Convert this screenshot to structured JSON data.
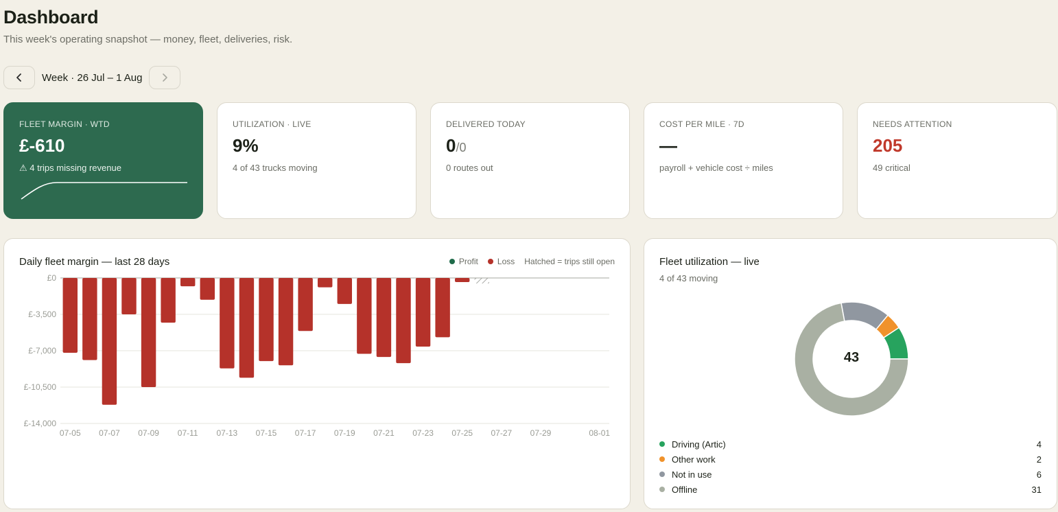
{
  "header": {
    "title": "Dashboard",
    "subtitle": "This week's operating snapshot — money, fleet, deliveries, risk."
  },
  "week_nav": {
    "prev_icon": "chevron-left-icon",
    "next_icon": "chevron-right-icon",
    "label": "Week · 26 Jul – 1 Aug"
  },
  "kpis": [
    {
      "label": "FLEET MARGIN · WTD",
      "value": "£-610",
      "sub": "⚠ 4 trips missing revenue",
      "accent": "#2d6a4f"
    },
    {
      "label": "UTILIZATION · LIVE",
      "value": "9%",
      "sub": "4 of 43 trucks moving"
    },
    {
      "label": "DELIVERED TODAY",
      "value": "0",
      "value_suffix": "/0",
      "sub": "0 routes out"
    },
    {
      "label": "COST PER MILE · 7D",
      "value": "—",
      "sub": "payroll + vehicle cost ÷ miles"
    },
    {
      "label": "NEEDS ATTENTION",
      "value": "205",
      "sub": "49 critical",
      "accent": "#c0392b"
    }
  ],
  "margin_chart": {
    "title": "Daily fleet margin — last 28 days",
    "legend": {
      "profit": "Profit",
      "loss": "Loss",
      "note": "Hatched = trips still open"
    },
    "colors": {
      "profit": "#1f6b4a",
      "loss": "#b5322a",
      "grid": "#e6e4dc",
      "axis": "#9a9c95"
    }
  },
  "chart_data": {
    "type": "bar",
    "title": "Daily fleet margin — last 28 days",
    "x": [
      "07-05",
      "07-06",
      "07-07",
      "07-08",
      "07-09",
      "07-10",
      "07-11",
      "07-12",
      "07-13",
      "07-14",
      "07-15",
      "07-16",
      "07-17",
      "07-18",
      "07-19",
      "07-20",
      "07-21",
      "07-22",
      "07-23",
      "07-24",
      "07-25",
      "07-26",
      "07-27",
      "07-28",
      "07-29",
      "07-30",
      "07-31",
      "08-01"
    ],
    "values": [
      -7200,
      -7900,
      -12200,
      -3500,
      -10500,
      -4300,
      -800,
      -2100,
      -8700,
      -9600,
      -8000,
      -8400,
      -5100,
      -900,
      -2500,
      -7300,
      -7600,
      -8200,
      -6600,
      -5700,
      -400,
      null,
      null,
      null,
      null,
      null,
      null,
      null
    ],
    "open_days": [
      "07-26"
    ],
    "tick_labels_x": [
      "07-05",
      "07-07",
      "07-09",
      "07-11",
      "07-13",
      "07-15",
      "07-17",
      "07-19",
      "07-21",
      "07-23",
      "07-25",
      "07-27",
      "07-29",
      "08-01"
    ],
    "tick_labels_y": [
      "£0",
      "£-3,500",
      "£-7,000",
      "£-10,500",
      "£-14,000"
    ],
    "y_ticks": [
      0,
      -3500,
      -7000,
      -10500,
      -14000
    ],
    "ylim": [
      -14000,
      0
    ],
    "grid": true,
    "legend_position": "top-right"
  },
  "utilization": {
    "title": "Fleet utilization — live",
    "subtitle": "4 of 43 moving",
    "total": "43",
    "segments": [
      {
        "label": "Driving (Artic)",
        "count": 4,
        "color": "#27a35e"
      },
      {
        "label": "Other work",
        "count": 2,
        "color": "#f0922b"
      },
      {
        "label": "Not in use",
        "count": 6,
        "color": "#9097a0"
      },
      {
        "label": "Offline",
        "count": 31,
        "color": "#a9b0a3"
      }
    ]
  }
}
